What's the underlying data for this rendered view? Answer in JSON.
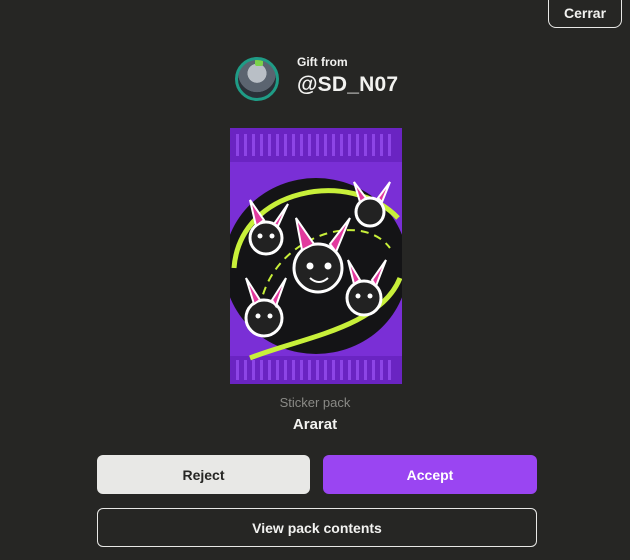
{
  "header": {
    "close_label": "Cerrar"
  },
  "gift": {
    "from_label": "Gift from",
    "sender": "@SD_N07"
  },
  "pack": {
    "type_label": "Sticker pack",
    "name": "Ararat",
    "image_icon": "sticker-pack-image"
  },
  "actions": {
    "reject_label": "Reject",
    "accept_label": "Accept",
    "view_contents_label": "View pack contents"
  },
  "colors": {
    "background": "#262624",
    "accent": "#9a45f2",
    "pack_purple": "#7a2fd6",
    "pack_lime": "#c8f03a",
    "pack_pink": "#e23a9e"
  }
}
